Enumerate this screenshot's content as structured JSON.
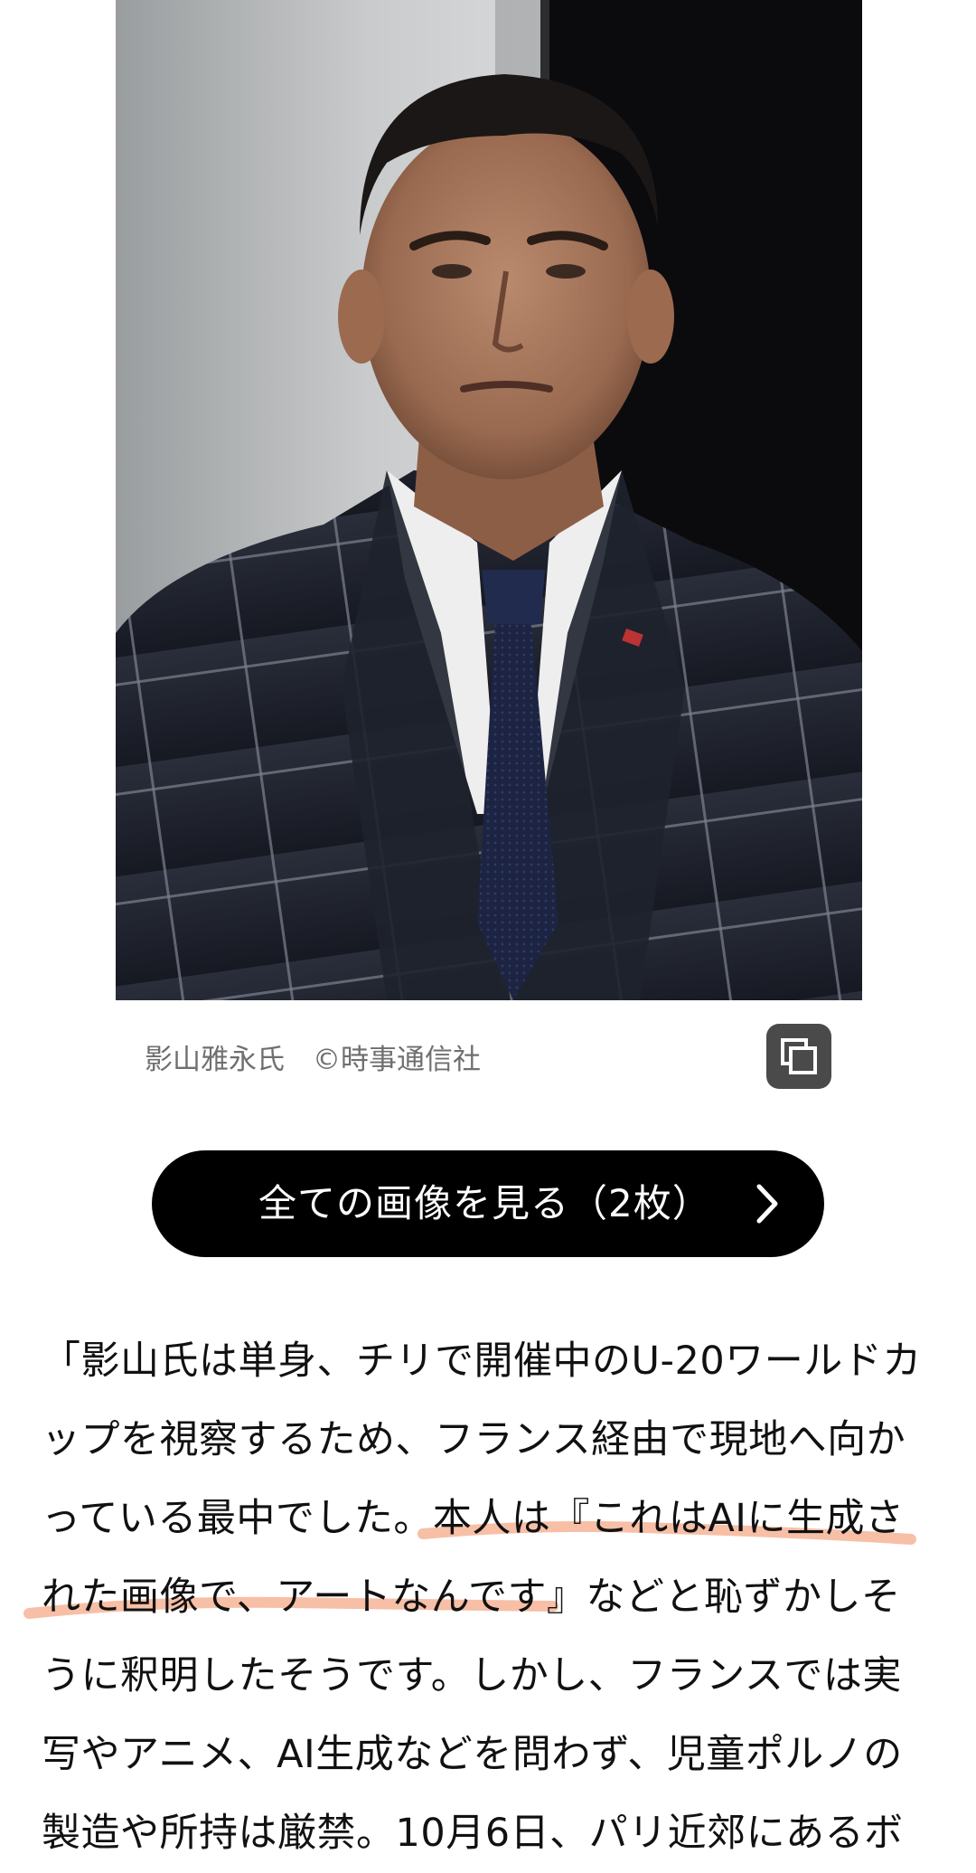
{
  "photo": {
    "subject": "man in checked suit and tie"
  },
  "caption": {
    "text": "影山雅永氏　©時事通信社"
  },
  "copy_button": {
    "icon": "copy-icon"
  },
  "view_all_button": {
    "label": "全ての画像を見る（2枚）",
    "icon": "chevron-right-icon"
  },
  "article": {
    "lines": [
      "「影山氏は単身、チリで開催中のU-20ワールドカ",
      "ップを視察するため、フランス経由で現地へ向か",
      "っている最中でした。本人は『これはAIに生成さ",
      "れた画像で、アートなんです』などと恥ずかしそ",
      "うに釈明したそうです。しかし、フランスでは実",
      "写やアニメ、AI生成などを問わず、児童ポルノの",
      "製造や所持は厳禁。10月6日、パリ近郊にあるボ"
    ]
  },
  "colors": {
    "highlight_underline": "#f6b89c",
    "button_bg": "#000000",
    "caption_text": "#6f6f6f"
  }
}
